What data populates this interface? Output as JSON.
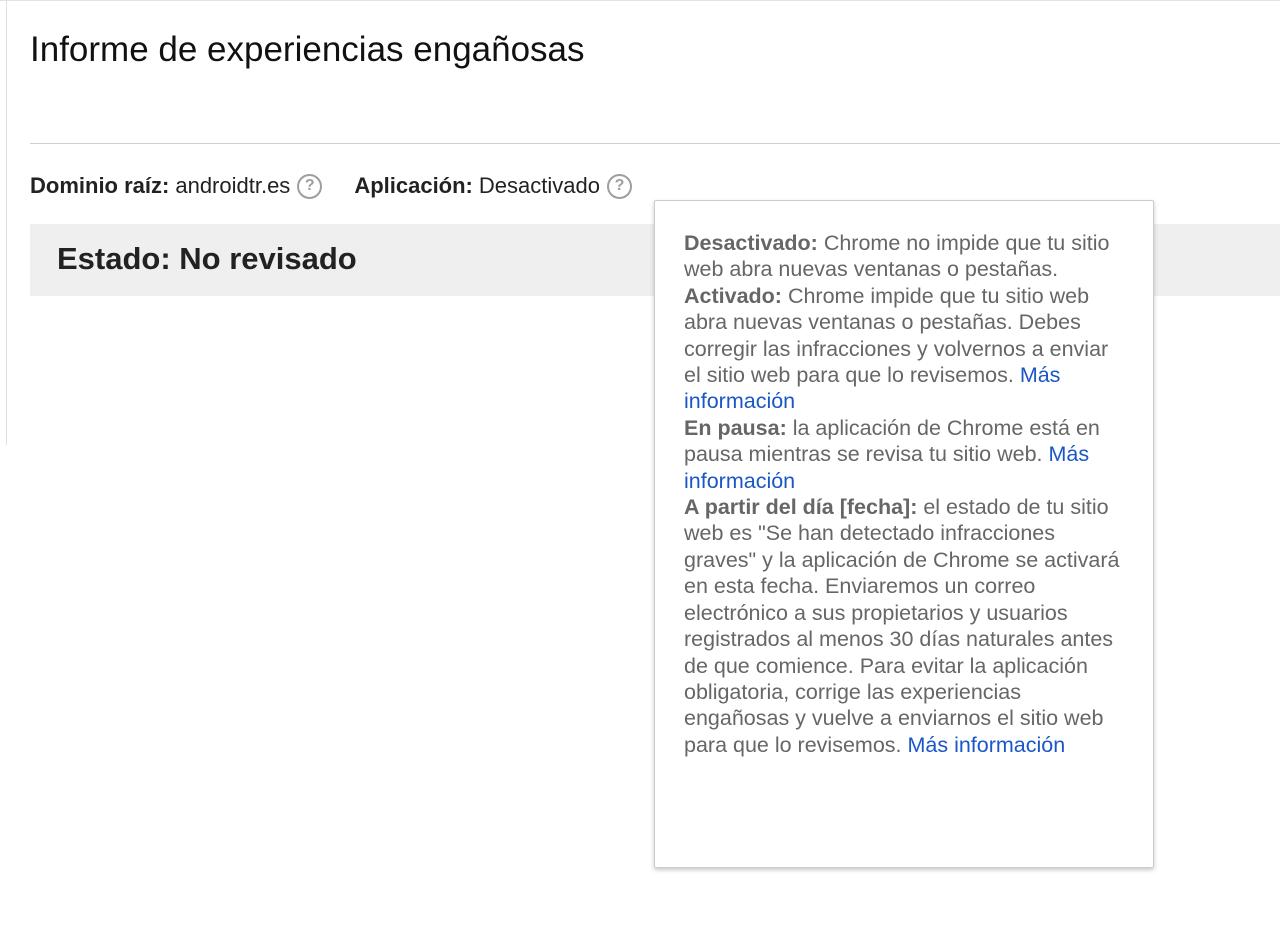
{
  "header": {
    "title": "Informe de experiencias engañosas"
  },
  "info": {
    "domain_label": "Dominio raíz:",
    "domain_value": "androidtr.es",
    "enforcement_label": "Aplicación:",
    "enforcement_value": "Desactivado",
    "help_icon_glyph": "?"
  },
  "status": {
    "title": "Estado: No revisado"
  },
  "tooltip": {
    "off": {
      "term": "Desactivado:",
      "text": " Chrome no impide que tu sitio web abra nuevas ventanas o pestañas."
    },
    "on": {
      "term": "Activado:",
      "text": " Chrome impide que tu sitio web abra nuevas ventanas o pestañas. Debes corregir las infracciones y volvernos a enviar el sitio web para que lo revisemos. ",
      "link": "Más información"
    },
    "paused": {
      "term": "En pausa:",
      "text": " la aplicación de Chrome está en pausa mientras se revisa tu sitio web. ",
      "link": "Más información"
    },
    "from_date": {
      "term": "A partir del día [fecha]:",
      "text": " el estado de tu sitio web es \"Se han detectado infracciones graves\" y la aplicación de Chrome se activará en esta fecha. Enviaremos un correo electrónico a sus propietarios y usuarios registrados al menos 30 días naturales antes de que comience. Para evitar la aplicación obligatoria, corrige las experiencias engañosas y vuelve a enviarnos el sitio web para que lo revisemos. ",
      "link": "Más información"
    }
  },
  "colors": {
    "link": "#1a56c8",
    "tooltip_text": "#666666",
    "status_bar": "#efefef",
    "help_icon": "#9e9e9e"
  }
}
